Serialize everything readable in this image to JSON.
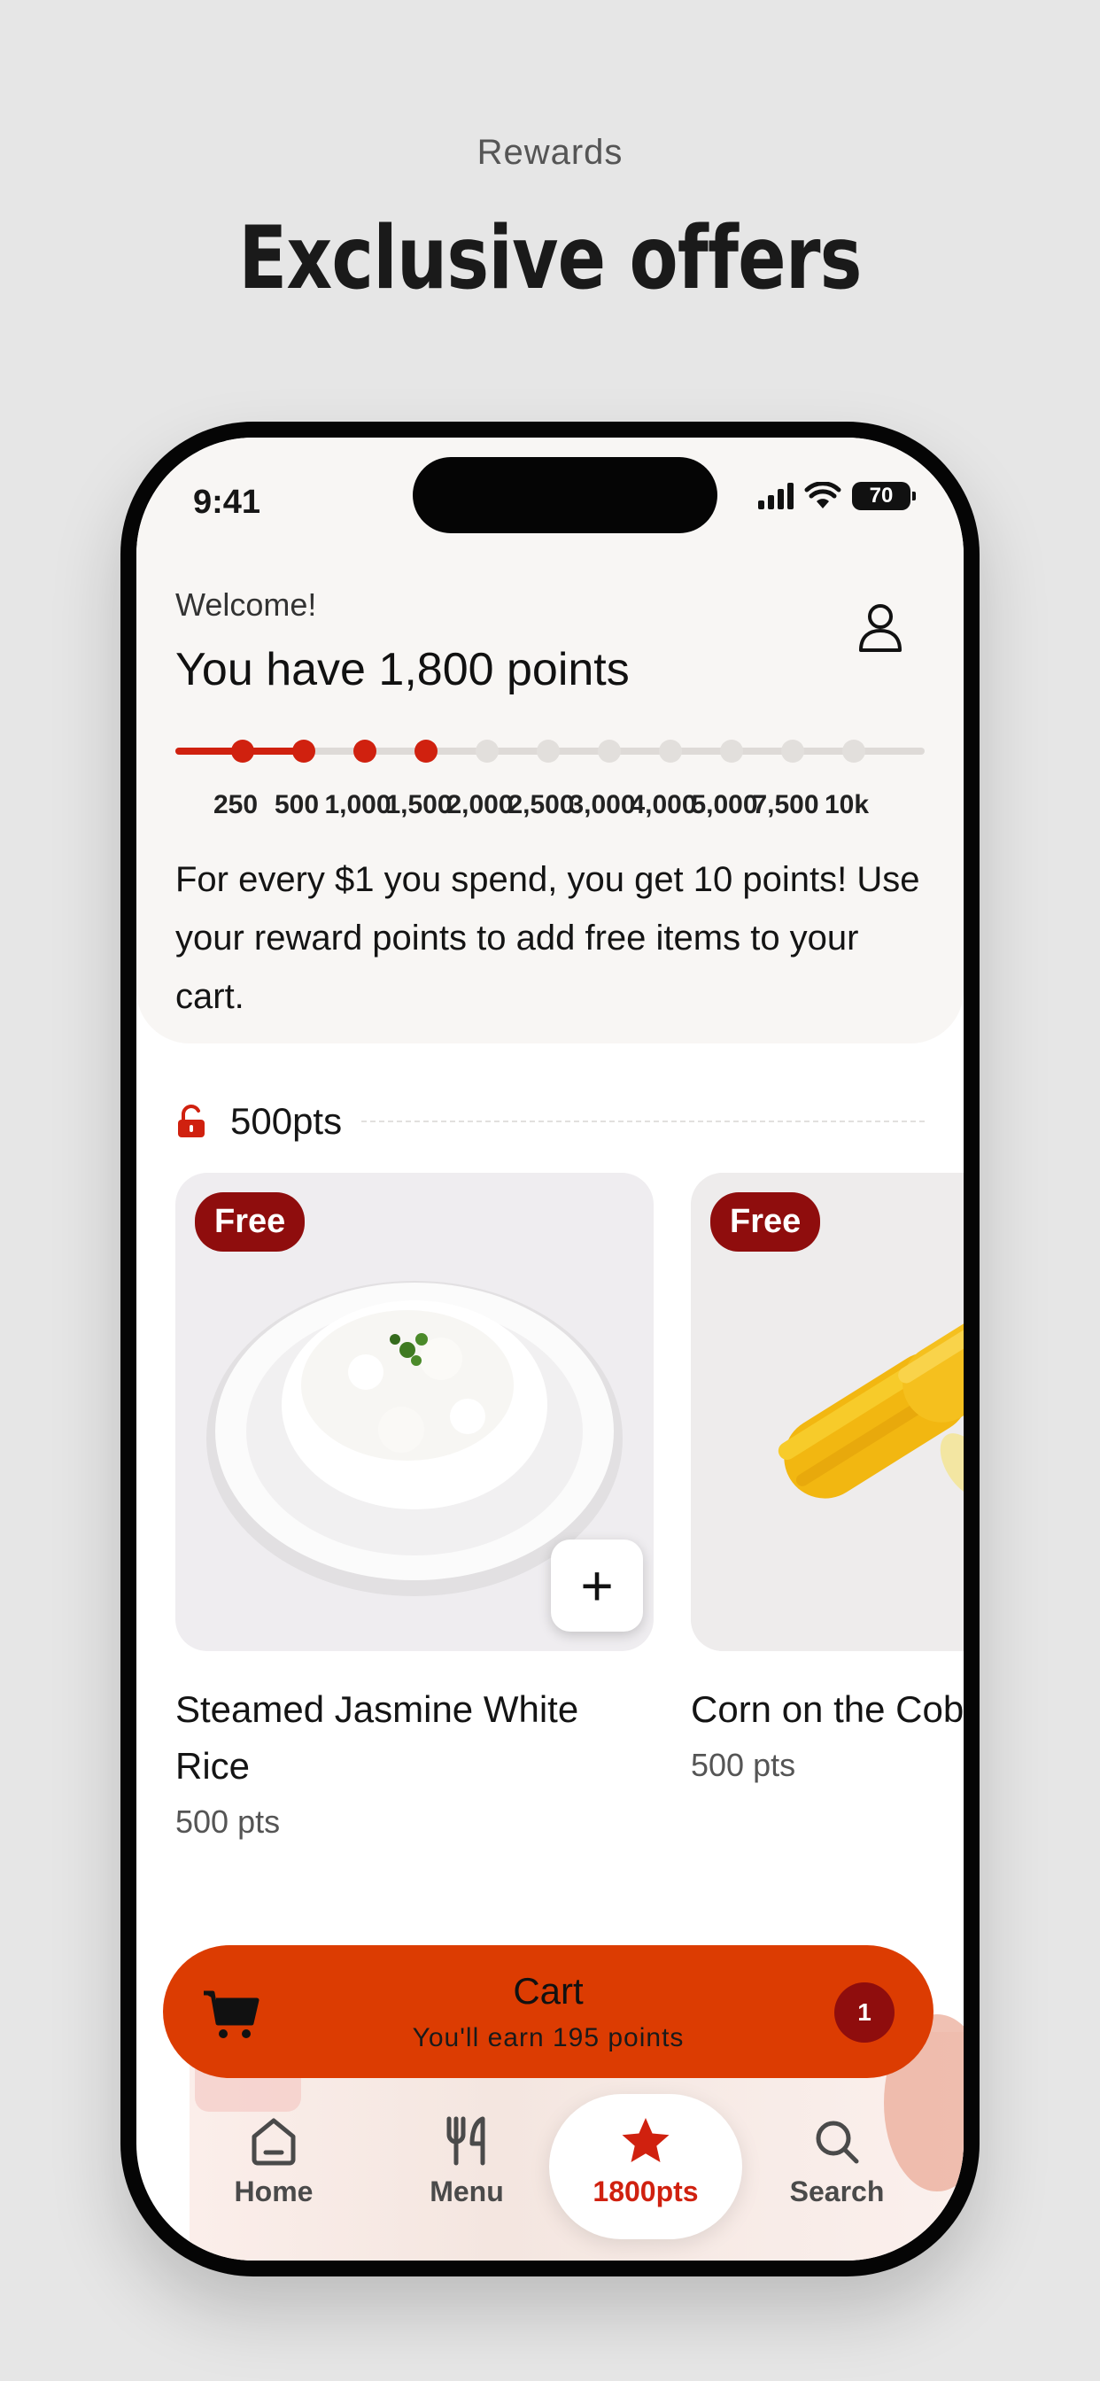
{
  "promo": {
    "subtitle": "Rewards",
    "title": "Exclusive offers"
  },
  "status_bar": {
    "time": "9:41",
    "battery": "70"
  },
  "header": {
    "welcome": "Welcome!",
    "points_title": "You have 1,800 points",
    "points": 1800,
    "description": "For every $1 you spend, you get 10 points! Use your reward points to add free items to your cart."
  },
  "progress": {
    "ticks": [
      "250",
      "500",
      "1,000",
      "1,500",
      "2,000",
      "2,500",
      "3,000",
      "4,000",
      "5,000",
      "7,500",
      "10k"
    ],
    "reached_count": 4,
    "fill_fraction": 0.17
  },
  "section": {
    "label": "500pts"
  },
  "items": [
    {
      "name": "Steamed Jasmine White Rice",
      "price": "500 pts",
      "badge": "Free"
    },
    {
      "name": "Corn on the Cob",
      "price": "500 pts",
      "badge": "Free"
    }
  ],
  "cart": {
    "title": "Cart",
    "subtitle": "You'll earn 195 points",
    "count": "1"
  },
  "tabs": [
    {
      "label": "Home",
      "icon": "home-icon"
    },
    {
      "label": "Menu",
      "icon": "utensils-icon"
    },
    {
      "label": "1800pts",
      "icon": "star-icon",
      "active": true
    },
    {
      "label": "Search",
      "icon": "search-icon"
    }
  ],
  "colors": {
    "accent": "#d0210f",
    "cart": "#dc3c02",
    "badge": "#8f0d0d"
  }
}
